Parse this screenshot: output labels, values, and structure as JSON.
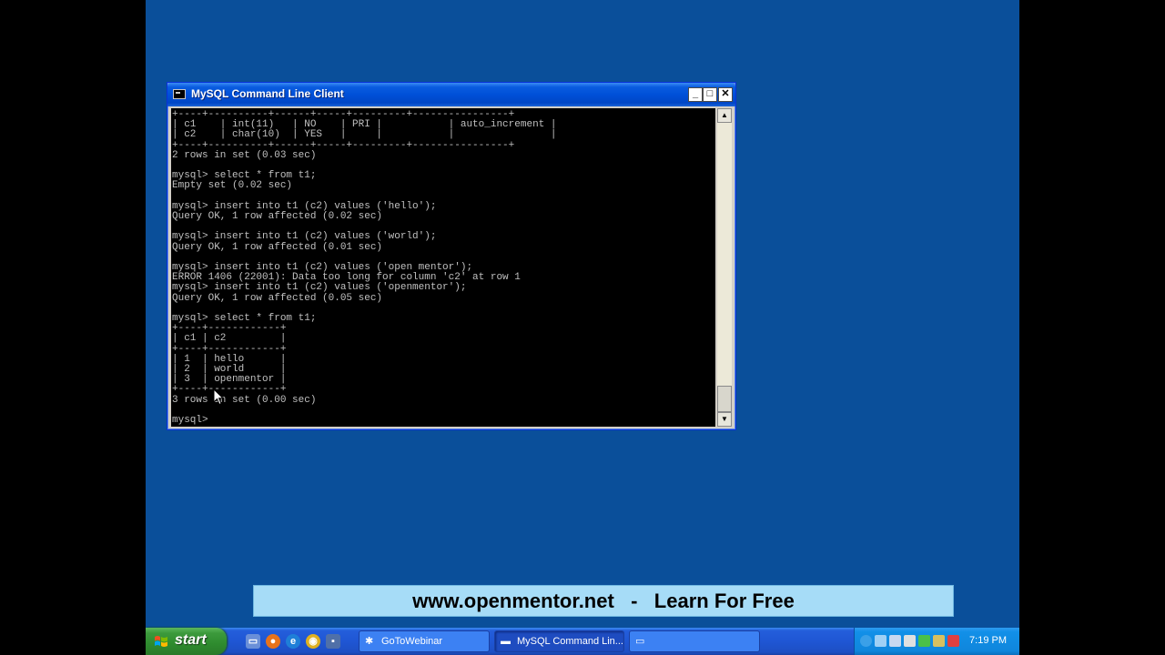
{
  "window": {
    "title": "MySQL Command Line Client",
    "minimize": "_",
    "maximize": "□",
    "close": "✕"
  },
  "console": {
    "lines": [
      "+----+----------+------+-----+---------+----------------+",
      "| c1    | int(11)   | NO    | PRI |           | auto_increment |",
      "| c2    | char(10)  | YES   |     |           |                |",
      "+----+----------+------+-----+---------+----------------+",
      "2 rows in set (0.03 sec)",
      "",
      "mysql> select * from t1;",
      "Empty set (0.02 sec)",
      "",
      "mysql> insert into t1 (c2) values ('hello');",
      "Query OK, 1 row affected (0.02 sec)",
      "",
      "mysql> insert into t1 (c2) values ('world');",
      "Query OK, 1 row affected (0.01 sec)",
      "",
      "mysql> insert into t1 (c2) values ('open mentor');",
      "ERROR 1406 (22001): Data too long for column 'c2' at row 1",
      "mysql> insert into t1 (c2) values ('openmentor');",
      "Query OK, 1 row affected (0.05 sec)",
      "",
      "mysql> select * from t1;",
      "+----+------------+",
      "| c1 | c2         |",
      "+----+------------+",
      "| 1  | hello      |",
      "| 2  | world      |",
      "| 3  | openmentor |",
      "+----+------------+",
      "3 rows in set (0.00 sec)",
      "",
      "mysql>"
    ]
  },
  "banner": {
    "text": "www.openmentor.net   -   Learn For Free"
  },
  "taskbar": {
    "start_label": "start",
    "tasks": [
      {
        "label": "GoToWebinar",
        "icon": "gotowebinar-icon"
      },
      {
        "label": "MySQL Command Lin...",
        "icon": "console-icon"
      },
      {
        "label": "",
        "icon": "window-icon"
      }
    ],
    "clock": "7:19 PM"
  },
  "colors": {
    "desktop": "#0a4f9a",
    "console_bg": "#000000",
    "console_text": "#c0c0c0",
    "banner_bg": "#a6dcf7",
    "titlebar": "#0050d8"
  }
}
